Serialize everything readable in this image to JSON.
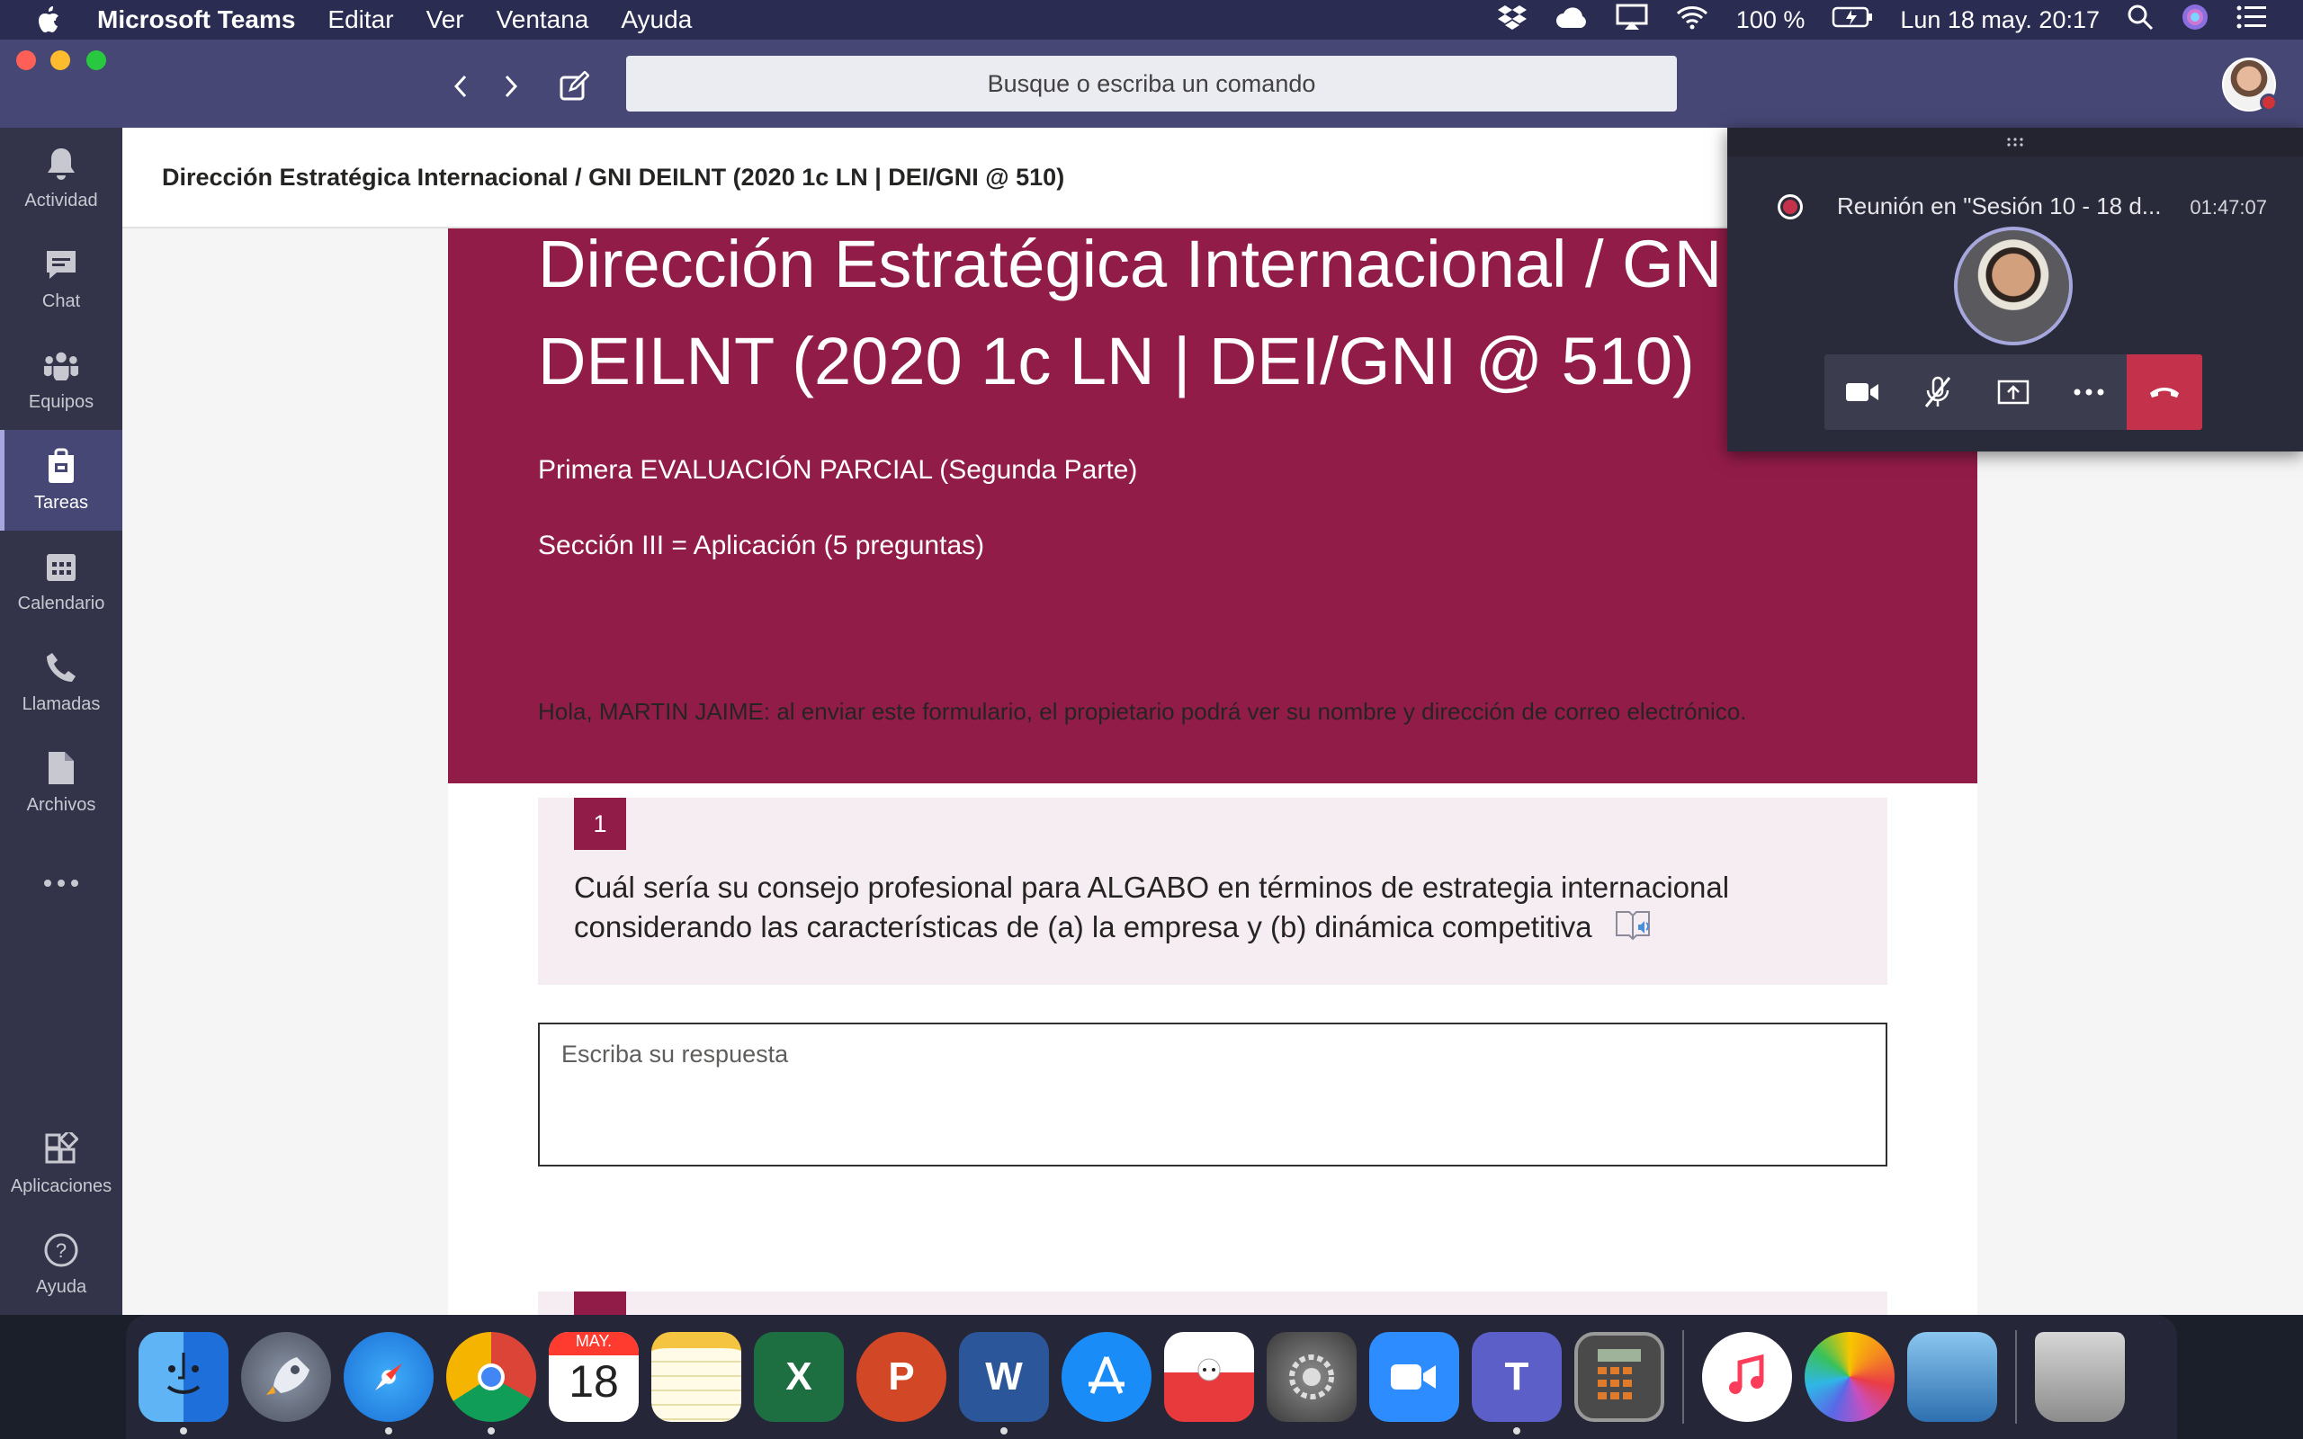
{
  "menubar": {
    "app_name": "Microsoft Teams",
    "menus": [
      "Editar",
      "Ver",
      "Ventana",
      "Ayuda"
    ],
    "battery": "100 %",
    "datetime": "Lun 18 may.  20:17"
  },
  "titlebar": {
    "search_placeholder": "Busque o escriba un comando"
  },
  "rail": {
    "items": [
      {
        "label": "Actividad",
        "icon": "bell-icon"
      },
      {
        "label": "Chat",
        "icon": "chat-icon"
      },
      {
        "label": "Equipos",
        "icon": "teams-icon"
      },
      {
        "label": "Tareas",
        "icon": "assignments-icon",
        "active": true
      },
      {
        "label": "Calendario",
        "icon": "calendar-icon"
      },
      {
        "label": "Llamadas",
        "icon": "phone-icon"
      },
      {
        "label": "Archivos",
        "icon": "files-icon"
      },
      {
        "label": "Aplicaciones",
        "icon": "apps-icon"
      },
      {
        "label": "Ayuda",
        "icon": "help-icon"
      }
    ]
  },
  "header": {
    "title": "Dirección Estratégica Internacional / GNI DEILNT (2020 1c LN | DEI/GNI @ 510)"
  },
  "form": {
    "title": "Dirección Estratégica Internacional / GNI DEILNT (2020 1c LN | DEI/GNI @ 510)",
    "subtitle1": "Primera EVALUACIÓN PARCIAL (Segunda Parte)",
    "subtitle2": "Sección III = Aplicación (5 preguntas)",
    "notice": "Hola, MARTIN JAIME: al enviar este formulario, el propietario podrá ver su nombre y dirección de correo electrónico.",
    "question1": {
      "number": "1",
      "text": "Cuál sería su consejo profesional para ALGABO en términos de estrategia internacional considerando las características de (a) la empresa y (b) dinámica competitiva"
    },
    "answer_placeholder": "Escriba su respuesta",
    "accent_color": "#921c48"
  },
  "meeting": {
    "title": "Reunión en \"Sesión 10 - 18 d...",
    "timer": "01:47:07"
  },
  "dock": {
    "calendar_month": "MAY.",
    "calendar_day": "18"
  }
}
